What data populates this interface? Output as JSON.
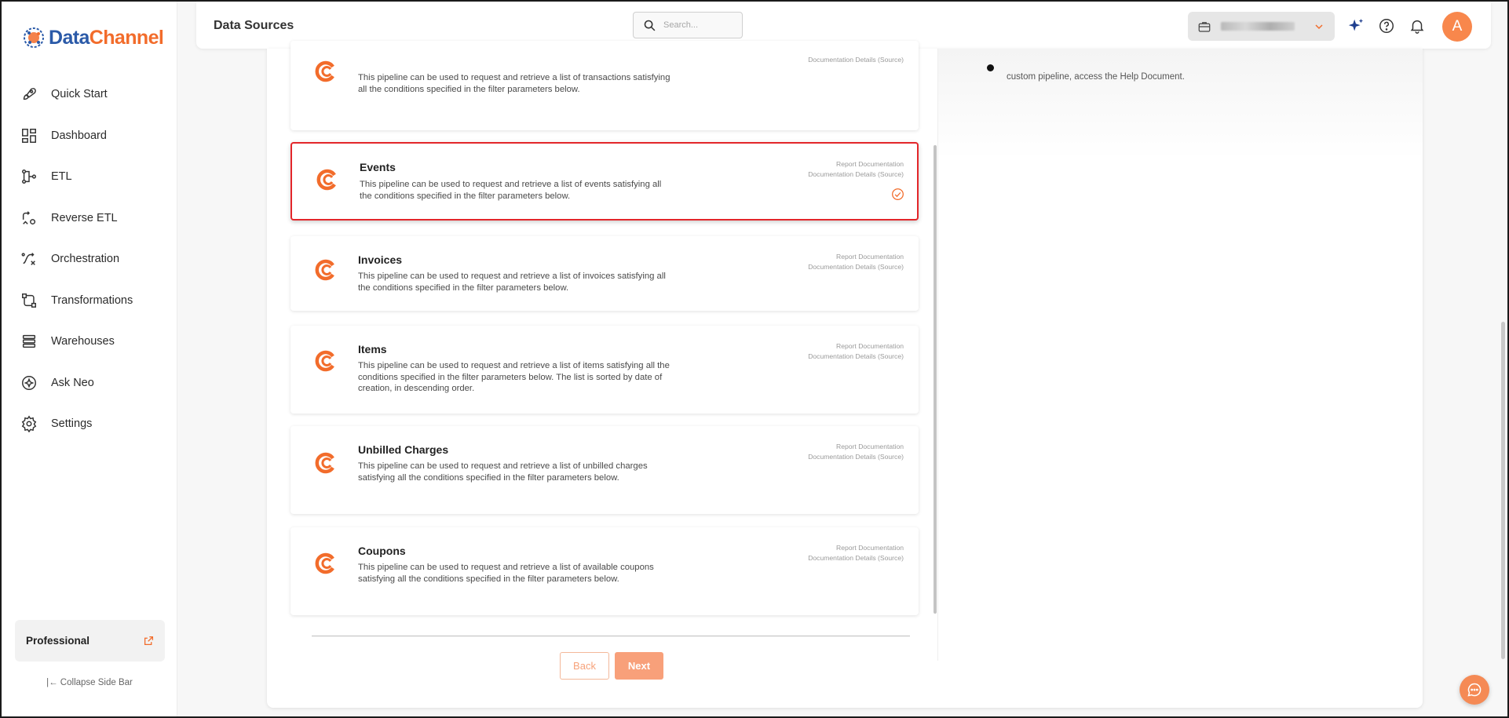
{
  "app": {
    "logo_text_data": "Data",
    "logo_text_channel": "Channel",
    "page_title": "Data Sources",
    "search_placeholder": "Search...",
    "avatar_letter": "A",
    "accent_color": "#f26c2b"
  },
  "sidebar": {
    "items": [
      {
        "label": "Quick Start",
        "icon": "rocket-icon"
      },
      {
        "label": "Dashboard",
        "icon": "dashboard-icon"
      },
      {
        "label": "ETL",
        "icon": "etl-icon"
      },
      {
        "label": "Reverse ETL",
        "icon": "reverse-etl-icon"
      },
      {
        "label": "Orchestration",
        "icon": "orchestration-icon"
      },
      {
        "label": "Transformations",
        "icon": "transformations-icon"
      },
      {
        "label": "Warehouses",
        "icon": "warehouses-icon"
      },
      {
        "label": "Ask Neo",
        "icon": "ask-neo-icon"
      },
      {
        "label": "Settings",
        "icon": "settings-icon"
      }
    ],
    "plan_label": "Professional",
    "collapse_label": "|← Collapse Side Bar"
  },
  "help_note": "custom pipeline, access the Help Document.",
  "pipelines": [
    {
      "title": "",
      "description": "This pipeline can be used to request and retrieve a list of transactions satisfying all the conditions specified in the filter parameters below.",
      "links": [
        "Documentation Details (Source)"
      ],
      "selected": false
    },
    {
      "title": "Events",
      "description": "This pipeline can be used to request and retrieve a list of events satisfying all the conditions specified in the filter parameters below.",
      "links": [
        "Report Documentation",
        "Documentation Details (Source)"
      ],
      "selected": true
    },
    {
      "title": "Invoices",
      "description": "This pipeline can be used to request and retrieve a list of invoices satisfying all the conditions specified in the filter parameters below.",
      "links": [
        "Report Documentation",
        "Documentation Details (Source)"
      ],
      "selected": false
    },
    {
      "title": "Items",
      "description": "This pipeline can be used to request and retrieve a list of items satisfying all the conditions specified in the filter parameters below. The list is sorted by date of creation, in descending order.",
      "links": [
        "Report Documentation",
        "Documentation Details (Source)"
      ],
      "selected": false
    },
    {
      "title": "Unbilled Charges",
      "description": "This pipeline can be used to request and retrieve a list of unbilled charges satisfying all the conditions specified in the filter parameters below.",
      "links": [
        "Report Documentation",
        "Documentation Details (Source)"
      ],
      "selected": false
    },
    {
      "title": "Coupons",
      "description": "This pipeline can be used to request and retrieve a list of available coupons satisfying all the conditions specified in the filter parameters below.",
      "links": [
        "Report Documentation",
        "Documentation Details (Source)"
      ],
      "selected": false
    }
  ],
  "buttons": {
    "back": "Back",
    "next": "Next"
  }
}
